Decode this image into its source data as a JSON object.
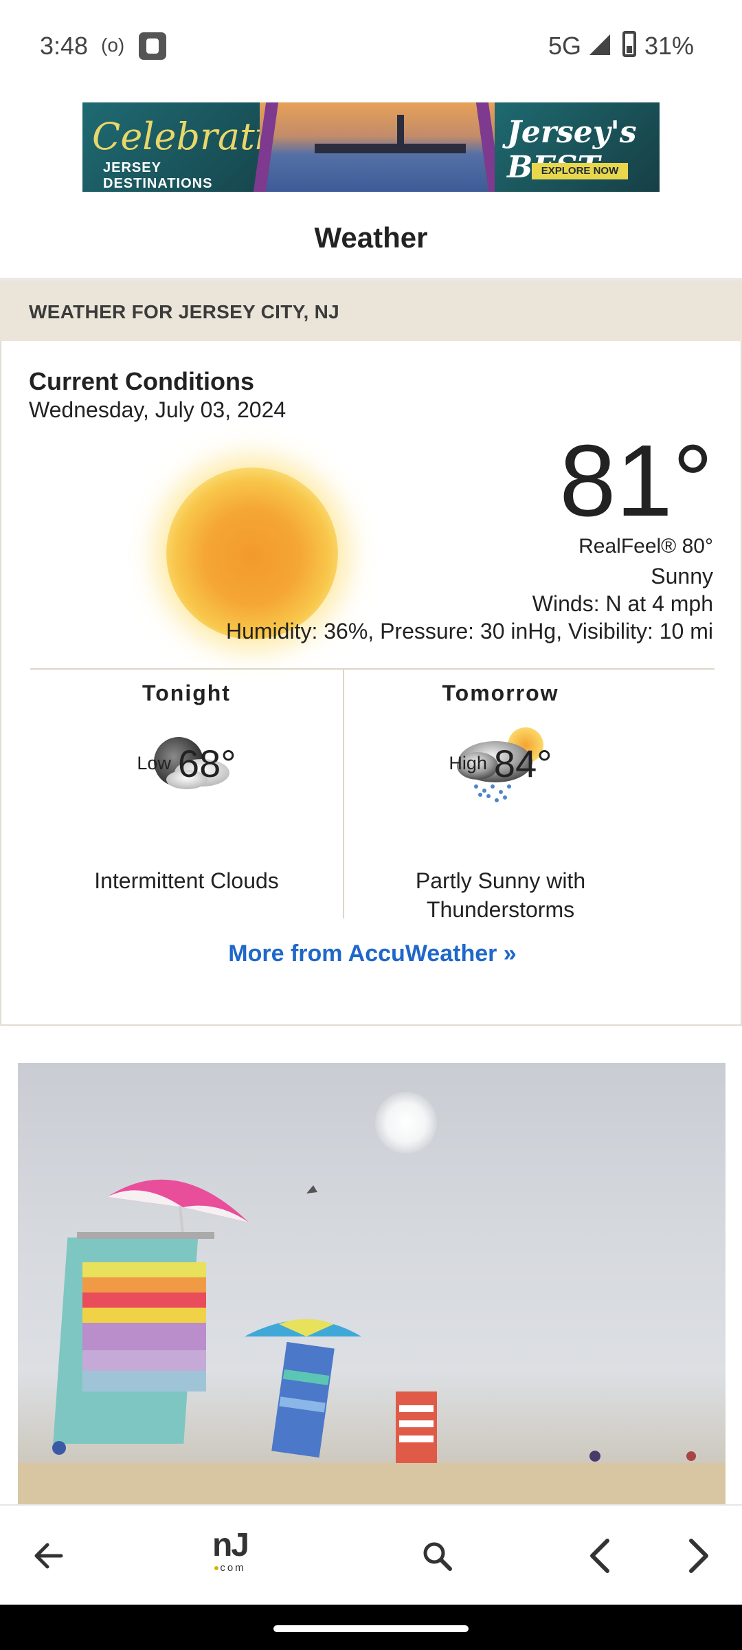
{
  "status_bar": {
    "time": "3:48",
    "radio_icon": "(o)",
    "network": "5G",
    "battery_pct": "31%",
    "icons": [
      "notification-app-icon",
      "signal-icon",
      "battery-icon"
    ]
  },
  "ad_banner": {
    "left_script": "Celebrating",
    "left_subtitle": "JERSEY DESTINATIONS",
    "right_title": "Jersey's BEST",
    "right_button": "EXPLORE NOW"
  },
  "page": {
    "title": "Weather"
  },
  "location_header": "WEATHER FOR JERSEY CITY, NJ",
  "current": {
    "title": "Current Conditions",
    "date": "Wednesday, July 03, 2024",
    "icon": "sun-icon",
    "temperature": "81°",
    "realfeel": "RealFeel® 80°",
    "condition": "Sunny",
    "winds": "Winds: N at 4 mph",
    "details": "Humidity: 36%, Pressure: 30 inHg, Visibility: 10 mi"
  },
  "forecast": [
    {
      "title": "Tonight",
      "icon": "cloudy-moon-icon",
      "label": "Low",
      "temp": "68°",
      "description": "Intermittent Clouds"
    },
    {
      "title": "Tomorrow",
      "icon": "thunderstorm-sun-icon",
      "label": "High",
      "temp": "84°",
      "description": "Partly Sunny with Thunderstorms"
    }
  ],
  "more_link": "More from AccuWeather »",
  "photo": {
    "subject": "beach-scene-photo"
  },
  "bottom_nav": {
    "logo_main": "nJ",
    "logo_sub": "com",
    "icons": [
      "back-arrow-icon",
      "nj-logo-icon",
      "search-icon",
      "chevron-left-icon",
      "chevron-right-icon"
    ]
  },
  "colors": {
    "link": "#1f67c9",
    "section_header_bg": "#ebe5d9",
    "sun_core": "#f29a2c"
  }
}
